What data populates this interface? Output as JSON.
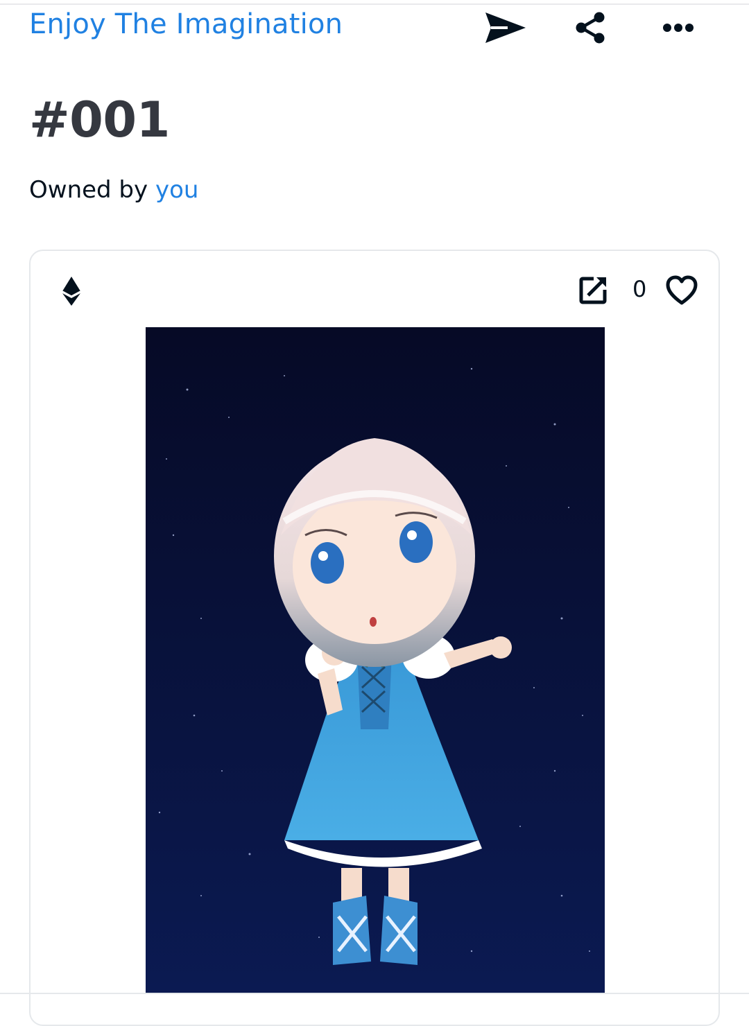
{
  "header": {
    "collection_name": "Enjoy The Imagination",
    "actions": [
      {
        "name": "transfer",
        "icon": "send-icon"
      },
      {
        "name": "share",
        "icon": "share-icon"
      },
      {
        "name": "more",
        "icon": "more-horizontal-icon"
      }
    ]
  },
  "item": {
    "title": "#001",
    "owned_by_label": "Owned by",
    "owner": "you"
  },
  "media_card": {
    "chain_icon": "ethereum-icon",
    "external_link_icon": "open-in-new-icon",
    "favorites_count": "0",
    "favorite_icon": "heart-outline-icon",
    "artwork_alt": "Chibi girl with short pale hair in a blue dress against a starry night sky"
  },
  "colors": {
    "link": "#2081e2",
    "title": "#353840",
    "text": "#04111d",
    "border": "#e5e8eb",
    "artwork_bg": "#080c2e",
    "dress": "#3a9ad8"
  }
}
